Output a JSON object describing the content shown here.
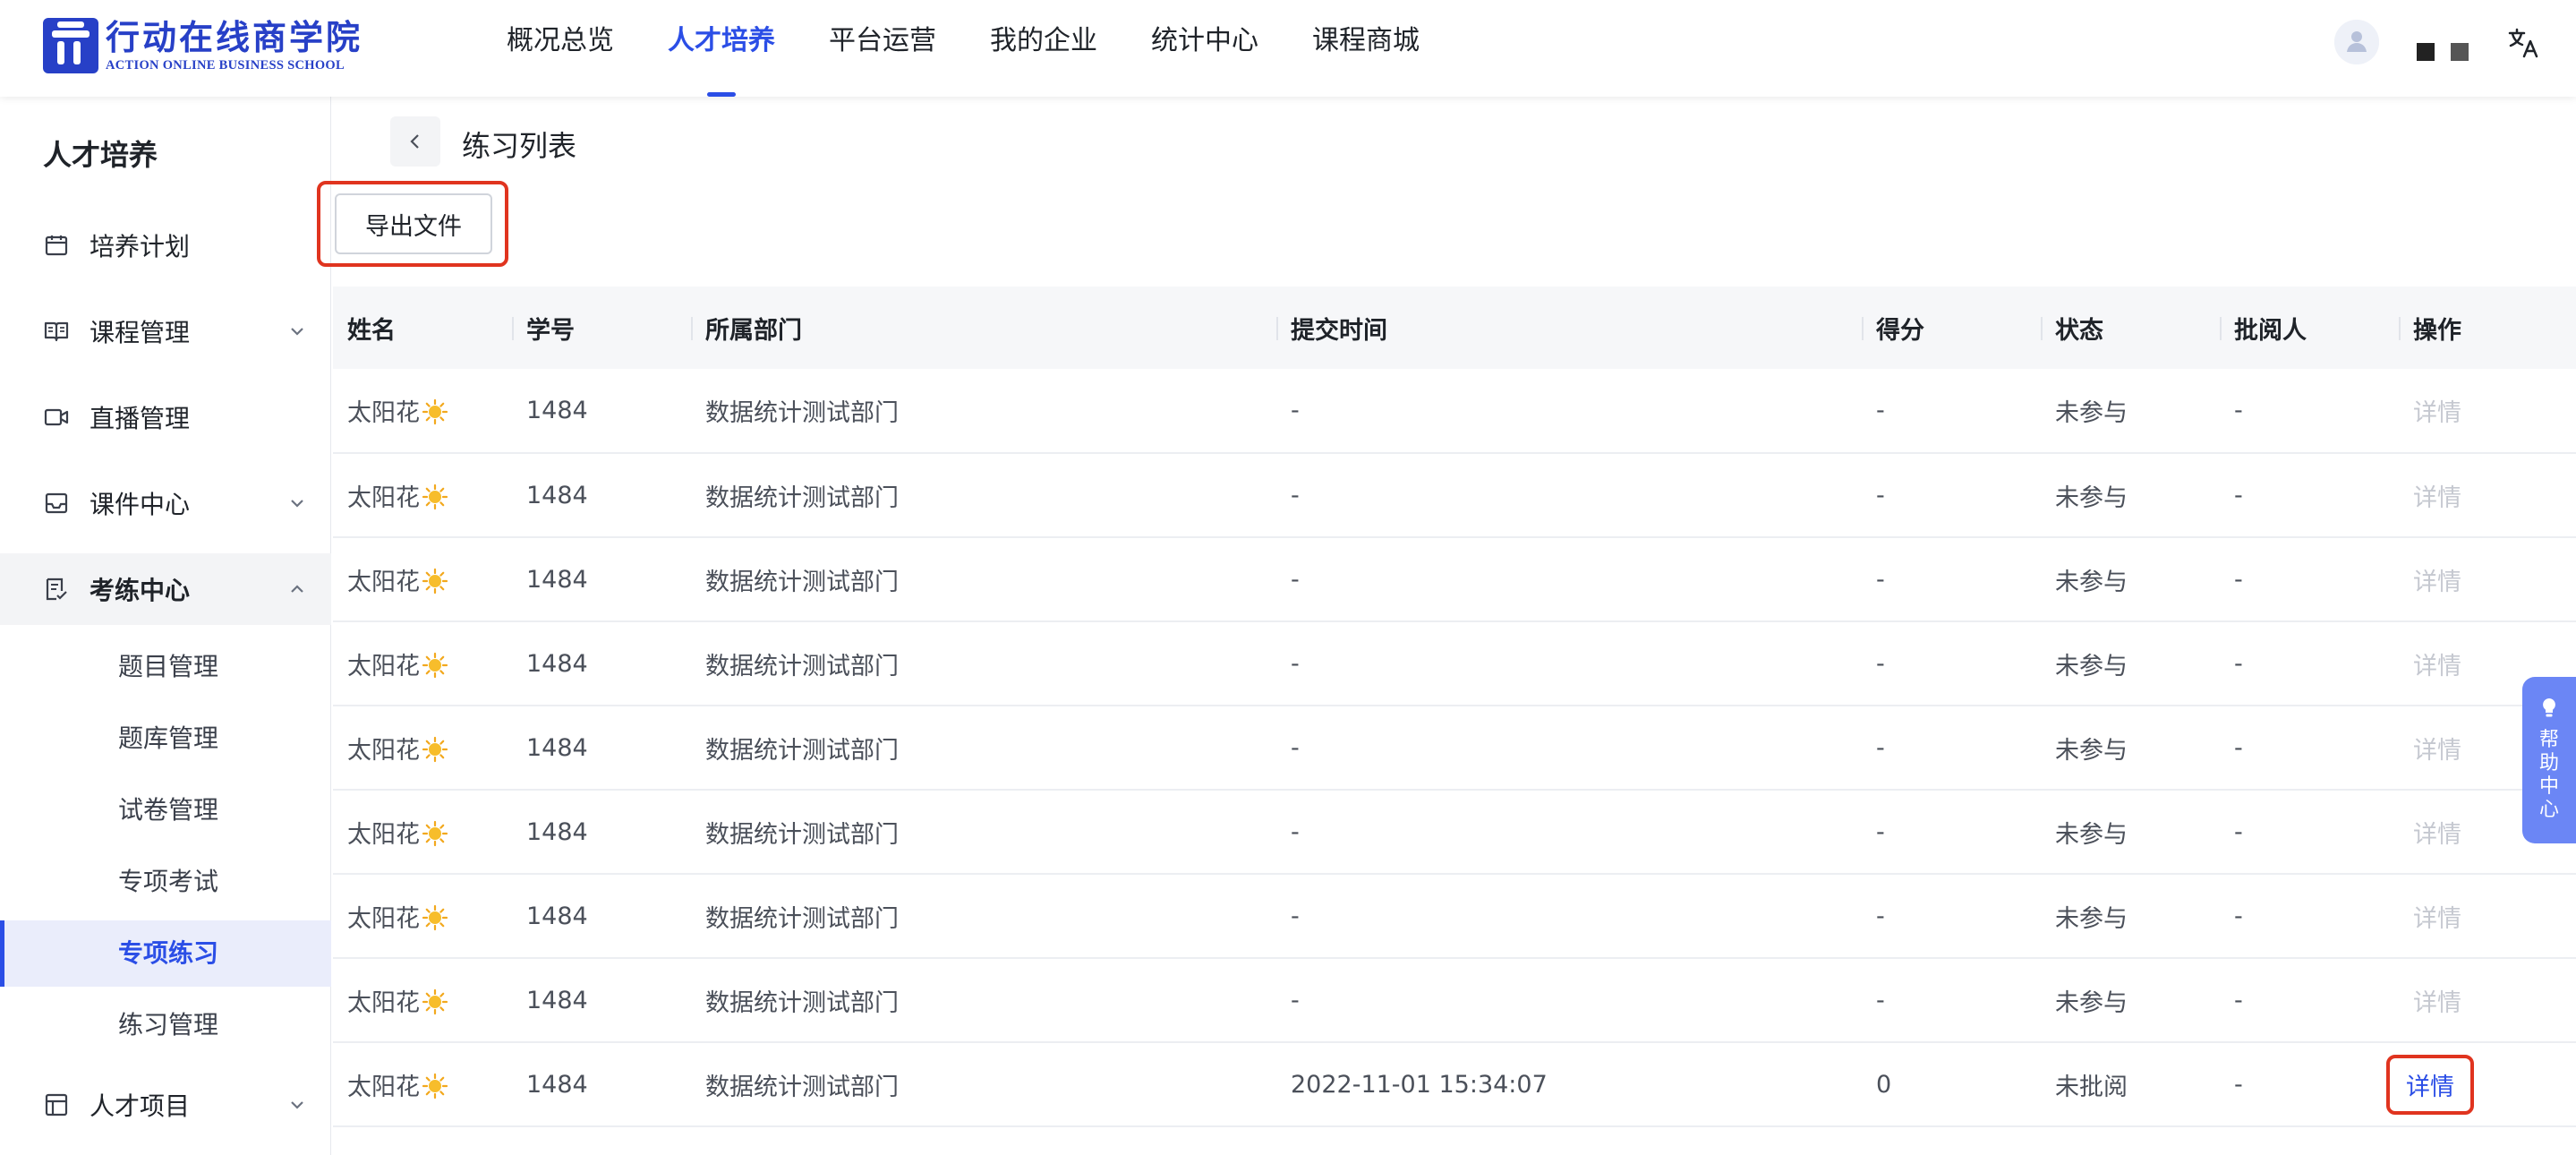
{
  "brand": {
    "name_cn": "行动在线商学院",
    "name_en": "ACTION ONLINE BUSINESS SCHOOL"
  },
  "nav": [
    {
      "label": "概况总览",
      "active": false
    },
    {
      "label": "人才培养",
      "active": true
    },
    {
      "label": "平台运营",
      "active": false
    },
    {
      "label": "我的企业",
      "active": false
    },
    {
      "label": "统计中心",
      "active": false
    },
    {
      "label": "课程商城",
      "active": false
    }
  ],
  "sidebar": {
    "title": "人才培养",
    "items": [
      {
        "label": "培养计划",
        "icon": "calendar-icon"
      },
      {
        "label": "课程管理",
        "icon": "book-icon"
      },
      {
        "label": "直播管理",
        "icon": "video-icon"
      },
      {
        "label": "课件中心",
        "icon": "inbox-icon"
      },
      {
        "label": "考练中心",
        "icon": "exam-icon"
      },
      {
        "label": "人才项目",
        "icon": "project-icon"
      }
    ],
    "sub_items": [
      {
        "label": "题目管理"
      },
      {
        "label": "题库管理"
      },
      {
        "label": "试卷管理"
      },
      {
        "label": "专项考试"
      },
      {
        "label": "专项练习"
      },
      {
        "label": "练习管理"
      }
    ]
  },
  "page": {
    "title": "练习列表",
    "export_label": "导出文件"
  },
  "table": {
    "columns": [
      "姓名",
      "学号",
      "所属部门",
      "提交时间",
      "得分",
      "状态",
      "批阅人",
      "操作"
    ],
    "rows": [
      {
        "name": "太阳花",
        "id": "1484",
        "dept": "数据统计测试部门",
        "time": "-",
        "score": "-",
        "status": "未参与",
        "reviewer": "-",
        "action": "详情"
      },
      {
        "name": "太阳花",
        "id": "1484",
        "dept": "数据统计测试部门",
        "time": "-",
        "score": "-",
        "status": "未参与",
        "reviewer": "-",
        "action": "详情"
      },
      {
        "name": "太阳花",
        "id": "1484",
        "dept": "数据统计测试部门",
        "time": "-",
        "score": "-",
        "status": "未参与",
        "reviewer": "-",
        "action": "详情"
      },
      {
        "name": "太阳花",
        "id": "1484",
        "dept": "数据统计测试部门",
        "time": "-",
        "score": "-",
        "status": "未参与",
        "reviewer": "-",
        "action": "详情"
      },
      {
        "name": "太阳花",
        "id": "1484",
        "dept": "数据统计测试部门",
        "time": "-",
        "score": "-",
        "status": "未参与",
        "reviewer": "-",
        "action": "详情"
      },
      {
        "name": "太阳花",
        "id": "1484",
        "dept": "数据统计测试部门",
        "time": "-",
        "score": "-",
        "status": "未参与",
        "reviewer": "-",
        "action": "详情"
      },
      {
        "name": "太阳花",
        "id": "1484",
        "dept": "数据统计测试部门",
        "time": "-",
        "score": "-",
        "status": "未参与",
        "reviewer": "-",
        "action": "详情"
      },
      {
        "name": "太阳花",
        "id": "1484",
        "dept": "数据统计测试部门",
        "time": "-",
        "score": "-",
        "status": "未参与",
        "reviewer": "-",
        "action": "详情"
      },
      {
        "name": "太阳花",
        "id": "1484",
        "dept": "数据统计测试部门",
        "time": "2022-11-01 15:34:07",
        "score": "0",
        "status": "未批阅",
        "reviewer": "-",
        "action": "详情"
      }
    ]
  },
  "help": {
    "label": "帮助中心"
  },
  "colors": {
    "accent": "#2b4ee6",
    "brand": "#2740c7",
    "highlight": "#e0341f",
    "disabled": "#c5c8d0"
  }
}
